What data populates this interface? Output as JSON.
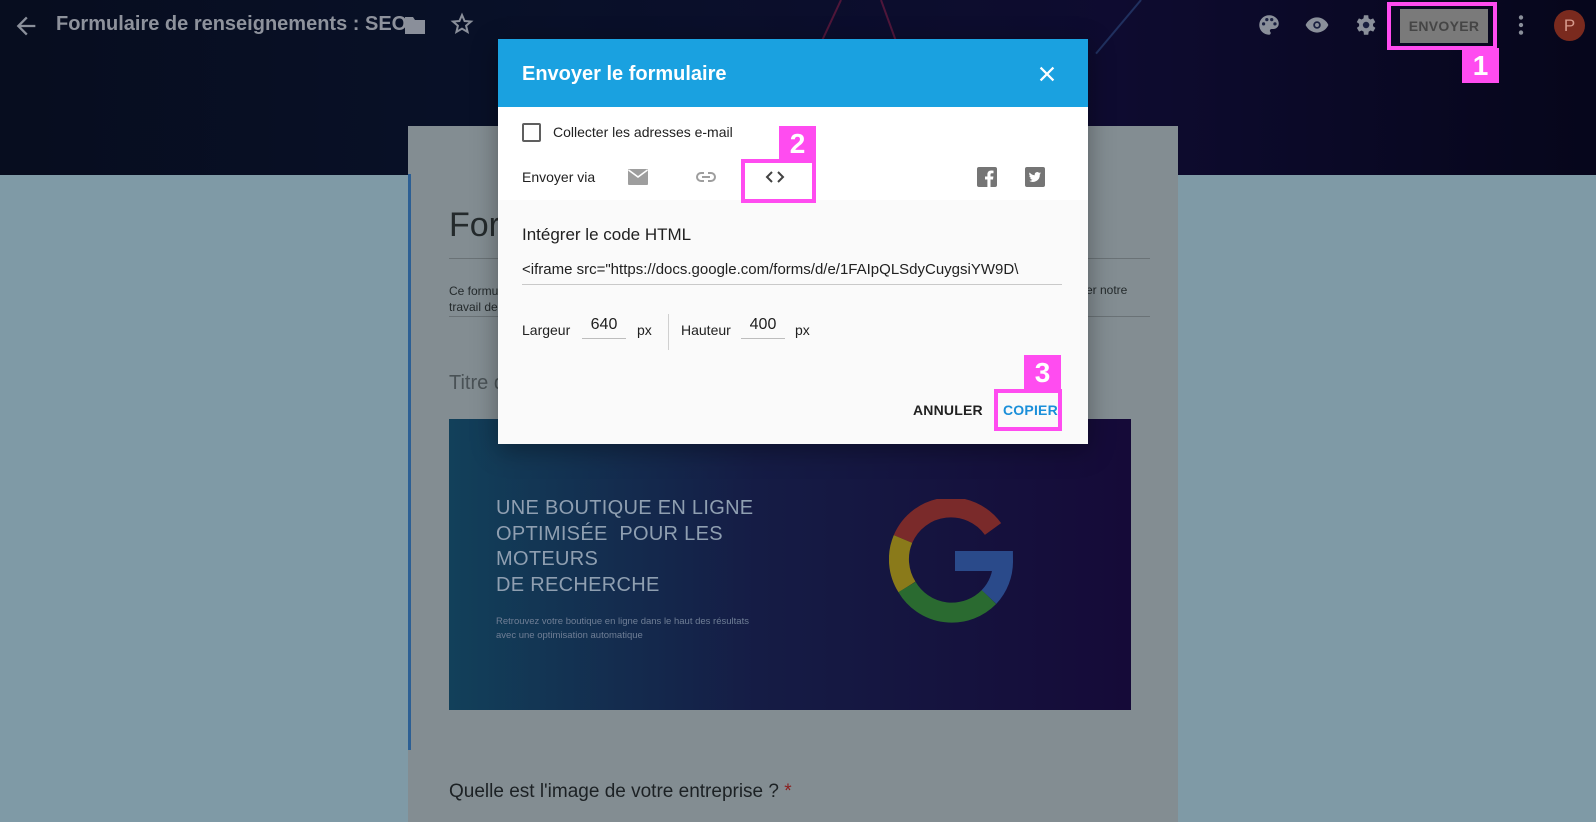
{
  "topbar": {
    "title": "Formulaire de renseignements : SEO",
    "send_label": "ENVOYER",
    "avatar_letter": "P",
    "icons": [
      "back-arrow-icon",
      "folder-icon",
      "star-icon",
      "palette-icon",
      "eye-icon",
      "gear-icon",
      "more-vert-icon"
    ]
  },
  "form": {
    "title_fragment": "For",
    "desc_left": "Ce formu\ntravail de",
    "desc_right": "er notre",
    "section_fragment": "Titre d",
    "banner": {
      "headline": [
        "UNE BOUTIQUE EN LIGNE",
        "OPTIMISÉE  POUR LES",
        "MOTEURS",
        "DE RECHERCHE"
      ],
      "subline": [
        "Retrouvez votre boutique en ligne dans le haut des résultats",
        "avec une optimisation automatique"
      ]
    },
    "question": "Quelle est l'image de votre entreprise ?",
    "required_mark": "*"
  },
  "dialog": {
    "title": "Envoyer le formulaire",
    "collect_email_label": "Collecter les adresses e-mail",
    "collect_email_checked": false,
    "send_via_label": "Envoyer via",
    "send_via_options": [
      "email-icon",
      "link-icon",
      "embed-code-icon",
      "facebook-icon",
      "twitter-icon"
    ],
    "selected_option": "embed-code-icon",
    "embed_title": "Intégrer le code HTML",
    "embed_code": "<iframe src=\"https://docs.google.com/forms/d/e/1FAIpQLSdyCuygsiYW9D\\",
    "width_label": "Largeur",
    "width_value": "640",
    "width_unit": "px",
    "height_label": "Hauteur",
    "height_value": "400",
    "height_unit": "px",
    "cancel_label": "ANNULER",
    "copy_label": "COPIER"
  },
  "annotations": [
    "1",
    "2",
    "3"
  ],
  "colors": {
    "dialog_header": "#1aa1e0",
    "annotation": "#ff4cf0",
    "copy_button": "#1a8fd9"
  }
}
